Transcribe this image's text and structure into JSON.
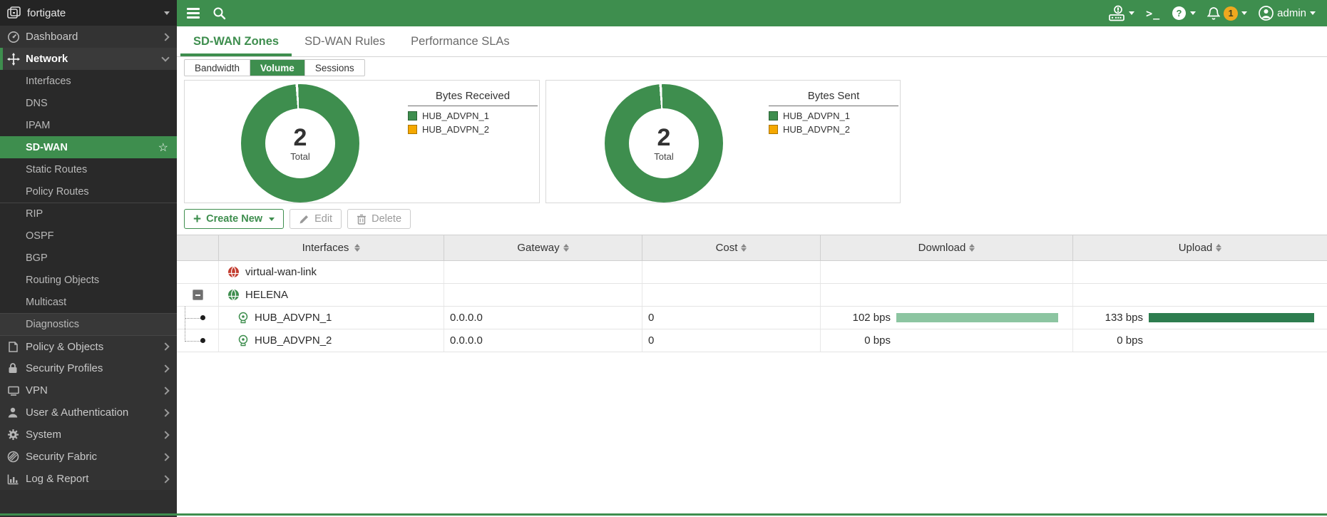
{
  "app": {
    "accent_green": "#3e8e4e",
    "accent_orange": "#f5a800"
  },
  "sidebar": {
    "logo_label": "fortigate",
    "items": [
      {
        "label": "Dashboard"
      },
      {
        "label": "Network"
      },
      {
        "label": "Interfaces"
      },
      {
        "label": "DNS"
      },
      {
        "label": "IPAM"
      },
      {
        "label": "SD-WAN"
      },
      {
        "label": "Static Routes"
      },
      {
        "label": "Policy Routes"
      },
      {
        "label": "RIP"
      },
      {
        "label": "OSPF"
      },
      {
        "label": "BGP"
      },
      {
        "label": "Routing Objects"
      },
      {
        "label": "Multicast"
      },
      {
        "label": "Diagnostics"
      },
      {
        "label": "Policy & Objects"
      },
      {
        "label": "Security Profiles"
      },
      {
        "label": "VPN"
      },
      {
        "label": "User & Authentication"
      },
      {
        "label": "System"
      },
      {
        "label": "Security Fabric"
      },
      {
        "label": "Log & Report"
      }
    ]
  },
  "topbar": {
    "cli_glyph": ">_",
    "notification_count": "1",
    "admin_label": "admin"
  },
  "tabs": [
    {
      "label": "SD-WAN Zones",
      "active": true
    },
    {
      "label": "SD-WAN Rules",
      "active": false
    },
    {
      "label": "Performance SLAs",
      "active": false
    }
  ],
  "subtabs": [
    {
      "label": "Bandwidth",
      "active": false
    },
    {
      "label": "Volume",
      "active": true
    },
    {
      "label": "Sessions",
      "active": false
    }
  ],
  "chart_data": [
    {
      "type": "pie",
      "title": "Bytes Received",
      "labels": [
        "HUB_ADVPN_1",
        "HUB_ADVPN_2"
      ],
      "values_pct": [
        99.3,
        0.7
      ],
      "colors": [
        "#3e8e4e",
        "#f5a800"
      ],
      "center_total": "2",
      "center_label": "Total",
      "legend_position": "right"
    },
    {
      "type": "pie",
      "title": "Bytes Sent",
      "labels": [
        "HUB_ADVPN_1",
        "HUB_ADVPN_2"
      ],
      "values_pct": [
        99.3,
        0.7
      ],
      "colors": [
        "#3e8e4e",
        "#f5a800"
      ],
      "center_total": "2",
      "center_label": "Total",
      "legend_position": "right"
    }
  ],
  "toolbar": {
    "create_label": "Create New",
    "edit_label": "Edit",
    "delete_label": "Delete"
  },
  "table": {
    "columns": [
      "Interfaces",
      "Gateway",
      "Cost",
      "Download",
      "Upload"
    ],
    "rows": [
      {
        "interface": "virtual-wan-link",
        "kind": "zone",
        "gateway": "",
        "cost": "",
        "download": "",
        "download_bar": "0%",
        "upload": "",
        "upload_bar": "0%"
      },
      {
        "interface": "HELENA",
        "kind": "zone",
        "gateway": "",
        "cost": "",
        "download": "",
        "download_bar": "0%",
        "upload": "",
        "upload_bar": "0%"
      },
      {
        "interface": "HUB_ADVPN_1",
        "kind": "member",
        "gateway": "0.0.0.0",
        "cost": "0",
        "download": "102 bps",
        "download_bar": "95%",
        "upload": "133 bps",
        "upload_bar": "96%"
      },
      {
        "interface": "HUB_ADVPN_2",
        "kind": "member",
        "gateway": "0.0.0.0",
        "cost": "0",
        "download": "0 bps",
        "download_bar": "0%",
        "upload": "0 bps",
        "upload_bar": "0%"
      }
    ]
  }
}
